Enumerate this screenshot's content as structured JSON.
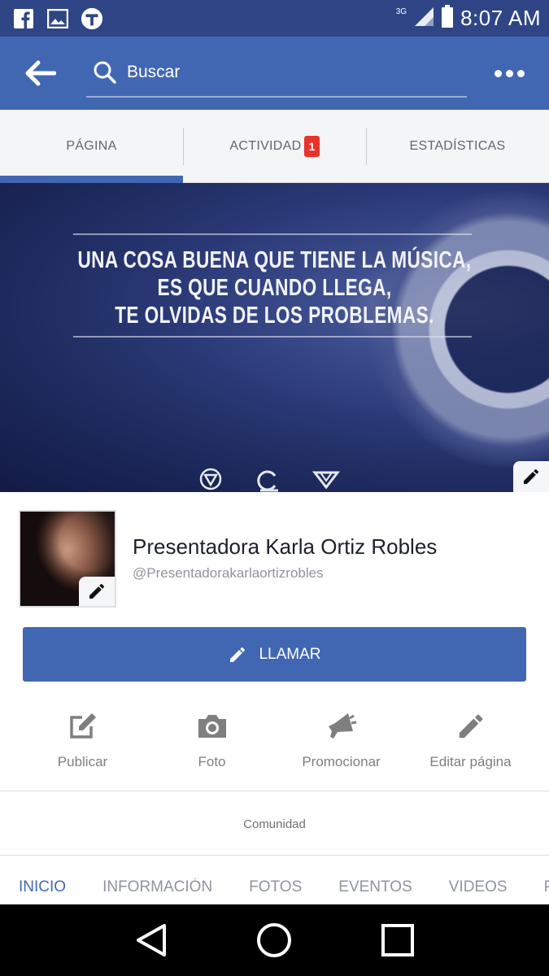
{
  "status_bar": {
    "network": "3G",
    "time": "8:07 AM",
    "icons": [
      "facebook-icon",
      "gallery-icon",
      "app-t-icon",
      "signal-icon",
      "battery-icon"
    ]
  },
  "app_bar": {
    "search_placeholder": "Buscar",
    "icons": [
      "back-arrow-icon",
      "search-icon",
      "more-options-icon"
    ]
  },
  "tabs": [
    {
      "label": "PÁGINA",
      "active": true
    },
    {
      "label": "ACTIVIDAD",
      "badge": "1"
    },
    {
      "label": "ESTADÍSTICAS"
    }
  ],
  "cover": {
    "lines": [
      "UNA COSA BUENA QUE TIENE LA MÚSICA,",
      "ES QUE CUANDO LLEGA,",
      "TE OLVIDAS DE LOS PROBLEMAS."
    ]
  },
  "profile": {
    "name": "Presentadora Karla Ortiz Robles",
    "handle": "@Presentadorakarlaortizrobles"
  },
  "call_button": {
    "label": "LLAMAR"
  },
  "actions": [
    {
      "label": "Publicar",
      "icon": "compose-icon"
    },
    {
      "label": "Foto",
      "icon": "camera-icon"
    },
    {
      "label": "Promocionar",
      "icon": "megaphone-icon"
    },
    {
      "label": "Editar página",
      "icon": "pencil-icon"
    }
  ],
  "community": {
    "label": "Comunidad"
  },
  "subnav": [
    "INICIO",
    "INFORMACIÓN",
    "FOTOS",
    "EVENTOS",
    "VIDEOS",
    "P"
  ],
  "colors": {
    "brand_blue": "#4267b2",
    "status_bar": "#2f4585",
    "badge_red": "#e8332c"
  }
}
